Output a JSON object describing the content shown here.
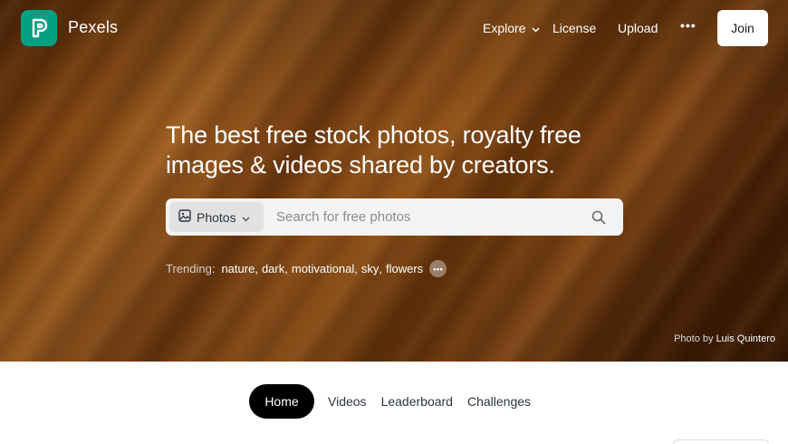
{
  "header": {
    "brand": "Pexels",
    "nav": {
      "explore": "Explore",
      "license": "License",
      "upload": "Upload",
      "more": "•••"
    },
    "join_label": "Join"
  },
  "hero": {
    "headline": "The best free stock photos, royalty free images & videos shared by creators.",
    "search": {
      "type_label": "Photos",
      "placeholder": "Search for free photos"
    },
    "trending": {
      "label": "Trending:",
      "terms": [
        "nature",
        "dark",
        "motivational",
        "sky",
        "flowers"
      ],
      "more": "•••"
    },
    "credit": {
      "prefix": "Photo by",
      "author": "Luis Quintero"
    }
  },
  "tabs": {
    "home": "Home",
    "videos": "Videos",
    "leaderboard": "Leaderboard",
    "challenges": "Challenges"
  },
  "colors": {
    "brand": "#05a081",
    "active_tab": "#000000"
  },
  "icons": {
    "logo": "pexels-logo-icon",
    "explore_chevron": "chevron-down-icon",
    "type_image": "image-icon",
    "type_chevron": "chevron-down-icon",
    "search": "search-icon"
  }
}
